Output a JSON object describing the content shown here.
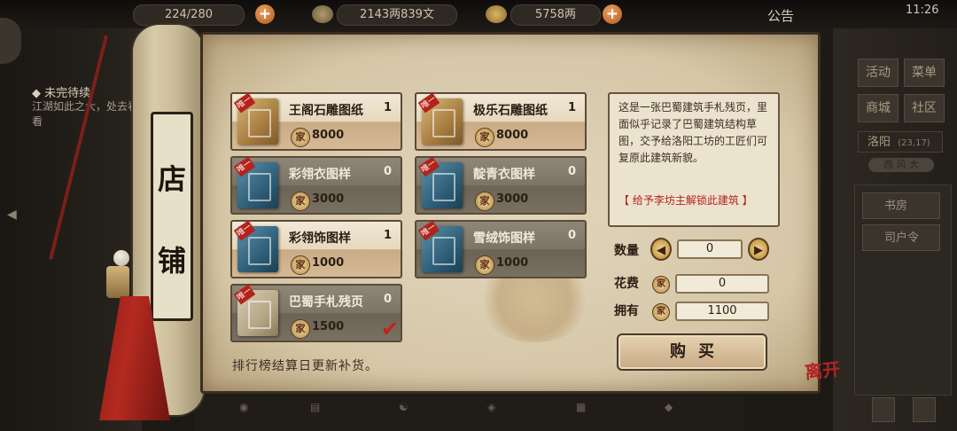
{
  "topbar": {
    "stamina": "224/280",
    "money": "2143两839文",
    "gold": "5758两",
    "notice": "公告",
    "time": "11:26"
  },
  "quest": {
    "title": "◆ 未完待续",
    "text": "江湖如此之大，处去看看"
  },
  "right_menu": {
    "activity": "活动",
    "menu": "菜单",
    "mall": "商城",
    "community": "社区",
    "location": "洛阳",
    "coords": "(23,17)",
    "weather": "西 风 大",
    "side_items": [
      "书房",
      "司户令"
    ]
  },
  "shop": {
    "title_chars": [
      "店",
      "铺"
    ],
    "unique_tag": "唯一",
    "currency_icon": "家",
    "items": [
      {
        "name": "王阁石雕图纸",
        "count": "1",
        "price": "8000"
      },
      {
        "name": "极乐石雕图纸",
        "count": "1",
        "price": "8000"
      },
      {
        "name": "彩翎衣图样",
        "count": "0",
        "price": "3000"
      },
      {
        "name": "靛青衣图样",
        "count": "0",
        "price": "3000"
      },
      {
        "name": "彩翎饰图样",
        "count": "1",
        "price": "1000"
      },
      {
        "name": "雪绒饰图样",
        "count": "0",
        "price": "1000"
      },
      {
        "name": "巴蜀手札残页",
        "count": "0",
        "price": "1500"
      }
    ],
    "restock_note": "排行榜结算日更新补货。",
    "description": "这是一张巴蜀建筑手札残页，里面似乎记录了巴蜀建筑结构草图，交予给洛阳工坊的工匠们可复原此建筑新貌。",
    "description_note": "【 给予李坊主解锁此建筑 】",
    "quantity_label": "数量",
    "quantity": "0",
    "cost_label": "花费",
    "cost": "0",
    "owned_label": "拥有",
    "owned": "1100",
    "buy_label": "购买"
  },
  "leave_label": "离开"
}
